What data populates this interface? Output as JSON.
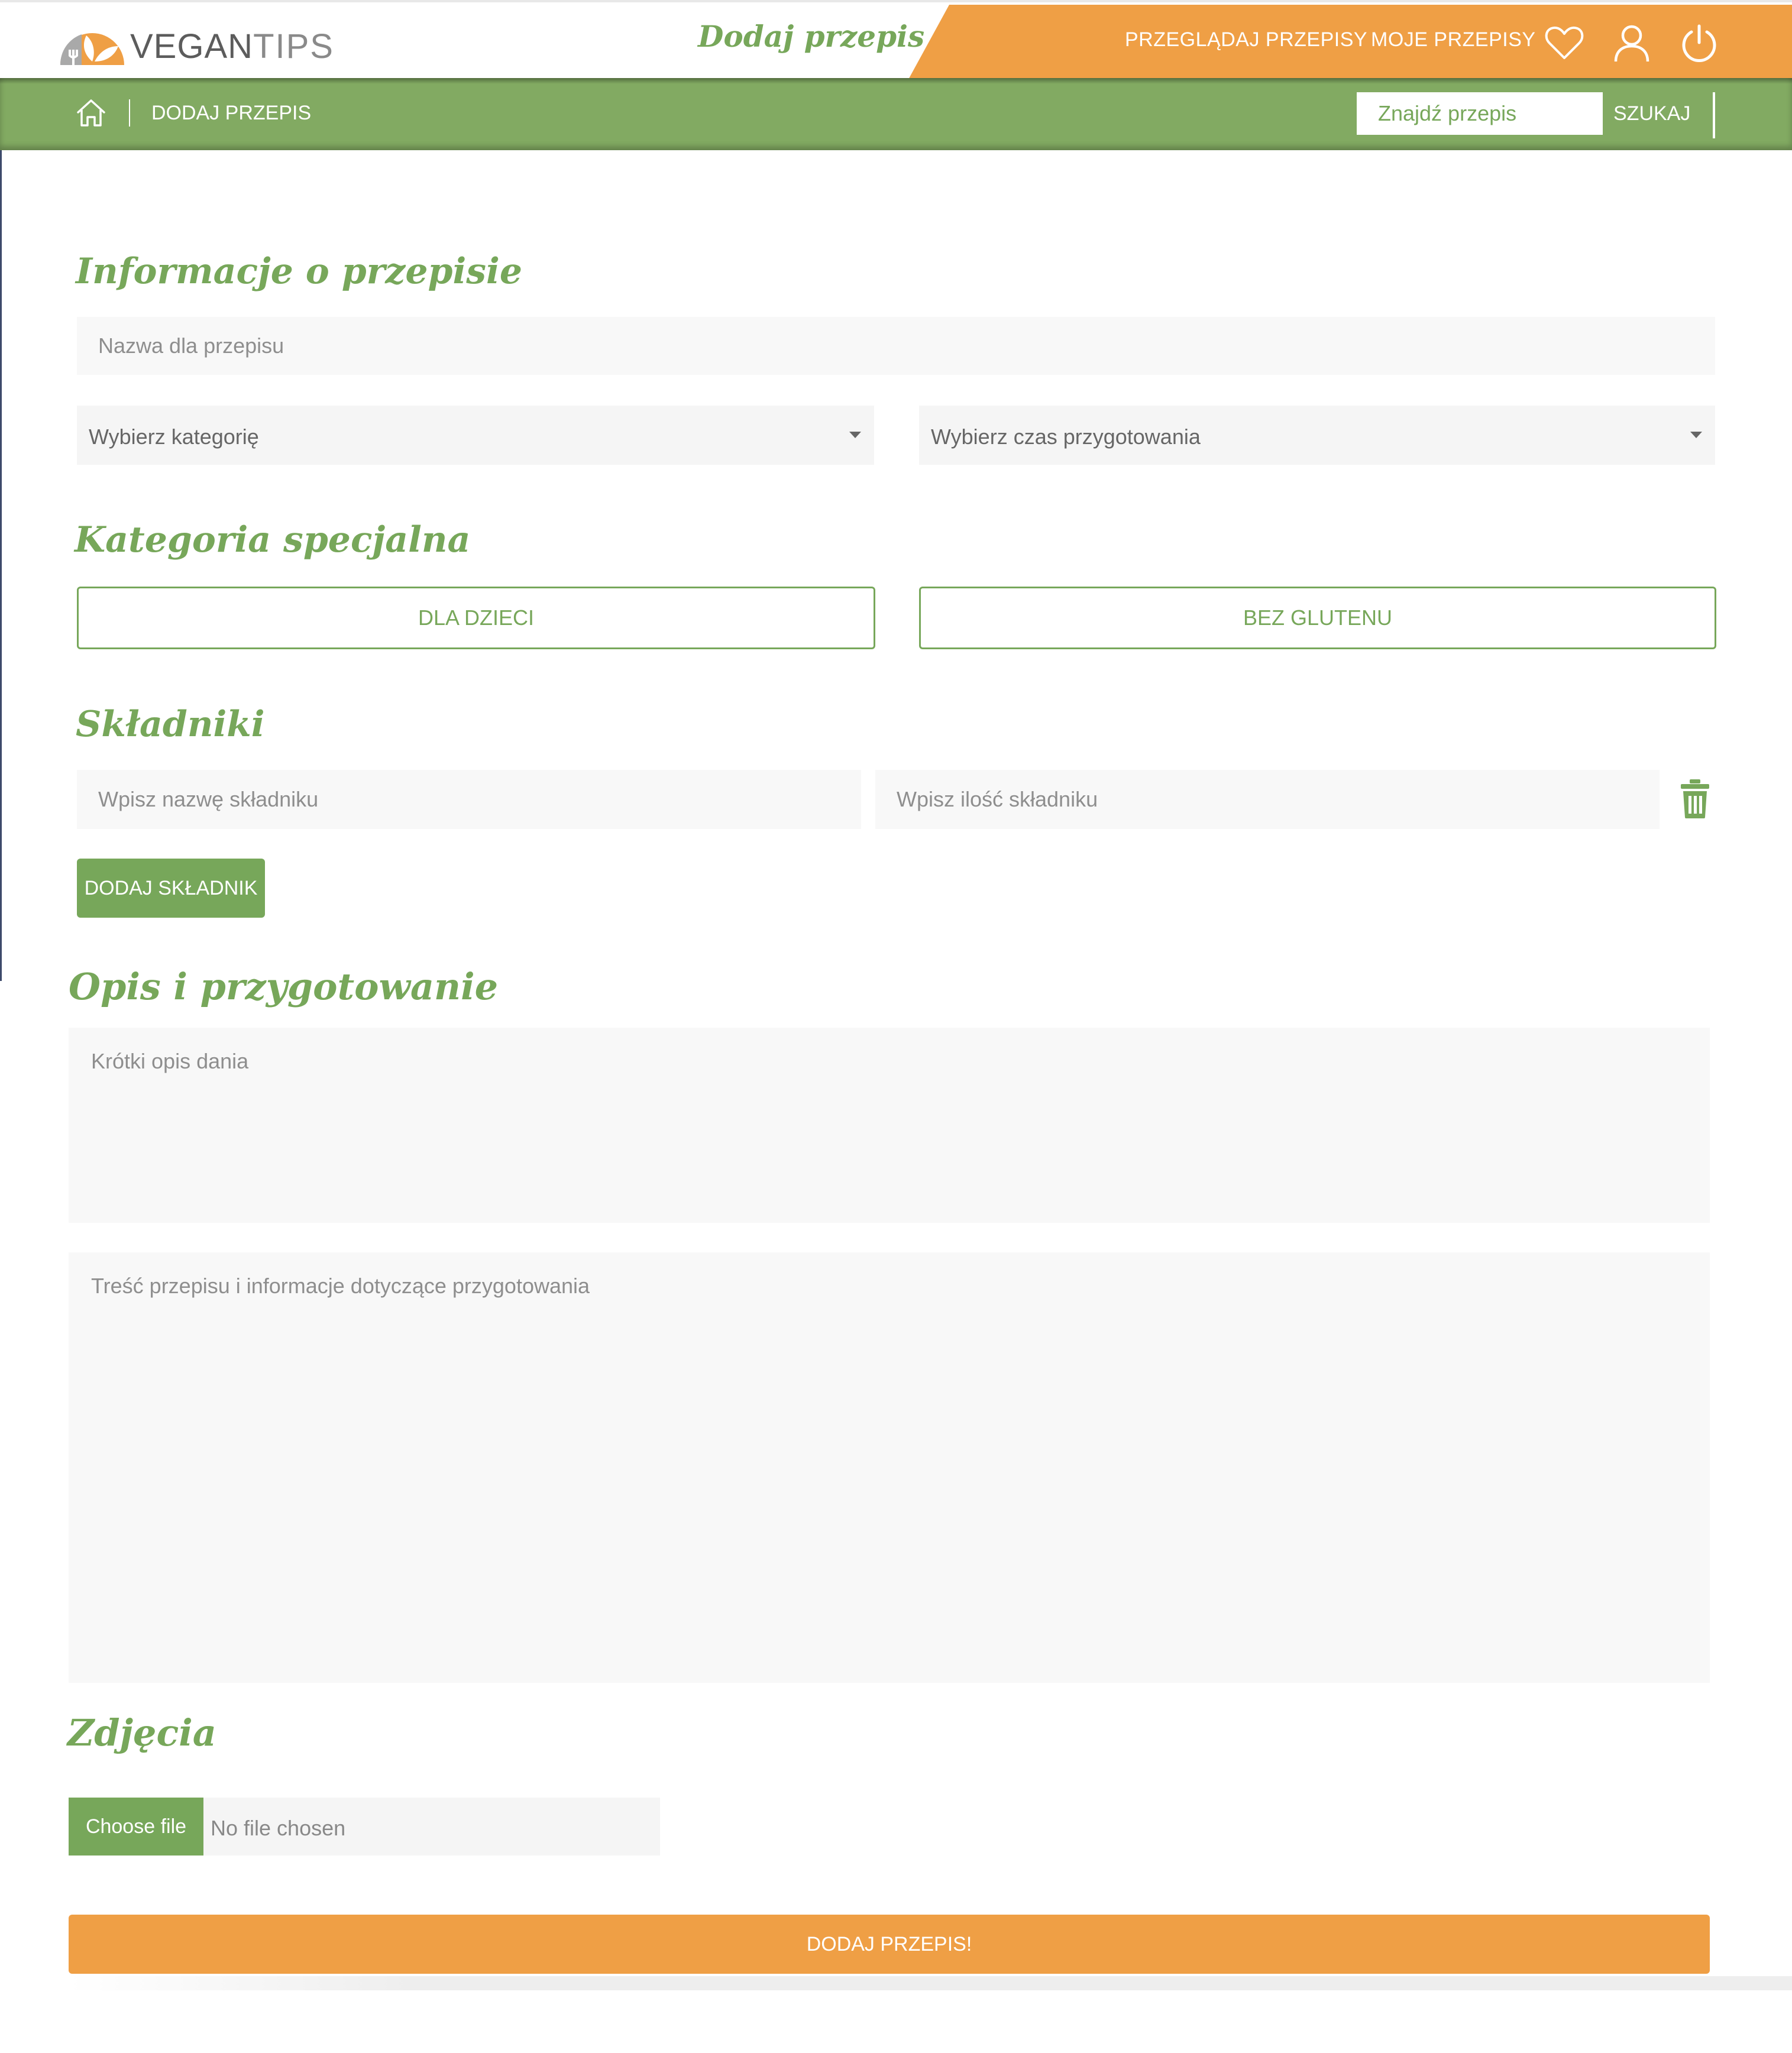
{
  "brand": {
    "logo_vegan": "VEGAN",
    "logo_tips": "TIPS",
    "primary_green": "#77a75a",
    "subbar_green": "#82aa62",
    "accent_orange": "#ef9f45"
  },
  "header": {
    "page_title": "Dodaj przepis",
    "nav": {
      "browse_label": "PRZEGLĄDAJ PRZEPISY",
      "mine_label": "MOJE PRZEPISY"
    },
    "icons": [
      "heart-icon",
      "user-icon",
      "power-icon"
    ]
  },
  "subbar": {
    "home_icon": "home-icon",
    "breadcrumb": "DODAJ PRZEPIS",
    "search_placeholder": "Znajdź przepis",
    "search_button": "SZUKAJ"
  },
  "form": {
    "info": {
      "title": "Informacje o przepisie",
      "name_placeholder": "Nazwa dla przepisu",
      "category_select": "Wybierz kategorię",
      "time_select": "Wybierz czas przygotowania"
    },
    "special": {
      "title": "Kategoria specjalna",
      "kids_label": "DLA DZIECI",
      "gluten_label": "BEZ GLUTENU"
    },
    "ingredients": {
      "title": "Składniki",
      "name_placeholder": "Wpisz nazwę składniku",
      "amount_placeholder": "Wpisz ilość składniku",
      "delete_icon": "trash-icon",
      "add_button": "DODAJ SKŁADNIK"
    },
    "description": {
      "title": "Opis i przygotowanie",
      "short_placeholder": "Krótki opis dania",
      "content_placeholder": "Treść przepisu i informacje dotyczące przygotowania"
    },
    "photos": {
      "title": "Zdjęcia",
      "choose_button": "Choose file",
      "file_status": "No file chosen"
    },
    "submit_label": "DODAJ PRZEPIS!"
  }
}
